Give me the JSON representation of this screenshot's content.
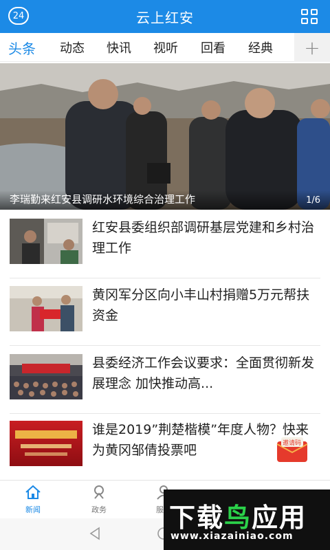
{
  "header": {
    "title": "云上红安",
    "badge_number": "24",
    "menu_icon": "grid-icon",
    "bg_color": "#1c8ae6"
  },
  "tabs": [
    {
      "label": "头条",
      "active": true
    },
    {
      "label": "动态",
      "active": false
    },
    {
      "label": "快讯",
      "active": false
    },
    {
      "label": "视听",
      "active": false
    },
    {
      "label": "回看",
      "active": false
    },
    {
      "label": "经典",
      "active": false
    }
  ],
  "tabs_more": "+",
  "hero": {
    "caption": "李瑞勤来红安县调研水环境综合治理工作",
    "pager": "1/6"
  },
  "news": [
    {
      "title": "红安县委组织部调研基层党建和乡村治理工作"
    },
    {
      "title": "黄冈军分区向小丰山村捐赠5万元帮扶资金"
    },
    {
      "title": "县委经济工作会议要求：全面贯彻新发展理念 加快推动高..."
    },
    {
      "title": "谁是2019”荆楚楷模”年度人物？快来为黄冈邹倩投票吧"
    }
  ],
  "invite_badge": {
    "label": "邀请码"
  },
  "bottom_nav": [
    {
      "label": "新闻",
      "icon": "home-icon",
      "active": true
    },
    {
      "label": "政务",
      "icon": "government-icon",
      "active": false
    },
    {
      "label": "服务",
      "icon": "service-icon",
      "active": false
    }
  ],
  "watermark": {
    "brand": "下载鸟应用",
    "url": "www.xiazainiao.com"
  }
}
